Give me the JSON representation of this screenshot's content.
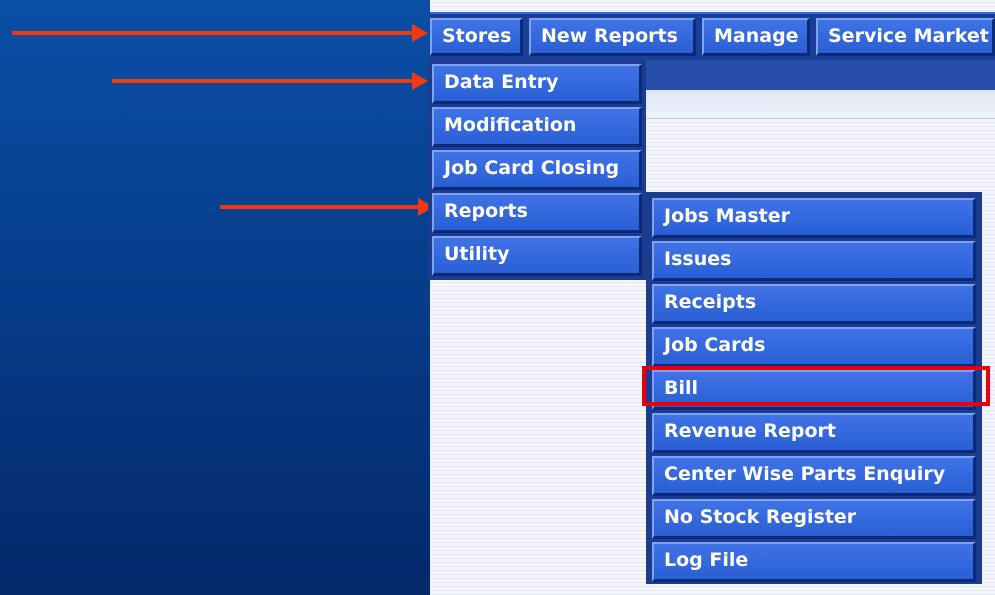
{
  "menubar": {
    "items": [
      {
        "label": "Stores"
      },
      {
        "label": "New Reports"
      },
      {
        "label": "Manage"
      },
      {
        "label": "Service Market"
      }
    ]
  },
  "stores_menu": {
    "items": [
      {
        "label": "Data Entry"
      },
      {
        "label": "Modification"
      },
      {
        "label": "Job Card Closing"
      },
      {
        "label": "Reports"
      },
      {
        "label": "Utility"
      }
    ]
  },
  "reports_menu": {
    "items": [
      {
        "label": "Jobs Master"
      },
      {
        "label": "Issues"
      },
      {
        "label": "Receipts"
      },
      {
        "label": "Job Cards"
      },
      {
        "label": "Bill"
      },
      {
        "label": "Revenue Report"
      },
      {
        "label": "Center Wise Parts Enquiry"
      },
      {
        "label": "No Stock Register"
      },
      {
        "label": "Log File"
      }
    ],
    "highlighted_item": "Bill"
  },
  "colors": {
    "arrow": "#f03a0e",
    "highlight": "#e8000e",
    "button": "#2a5ed4",
    "background_left": "#063a86"
  }
}
